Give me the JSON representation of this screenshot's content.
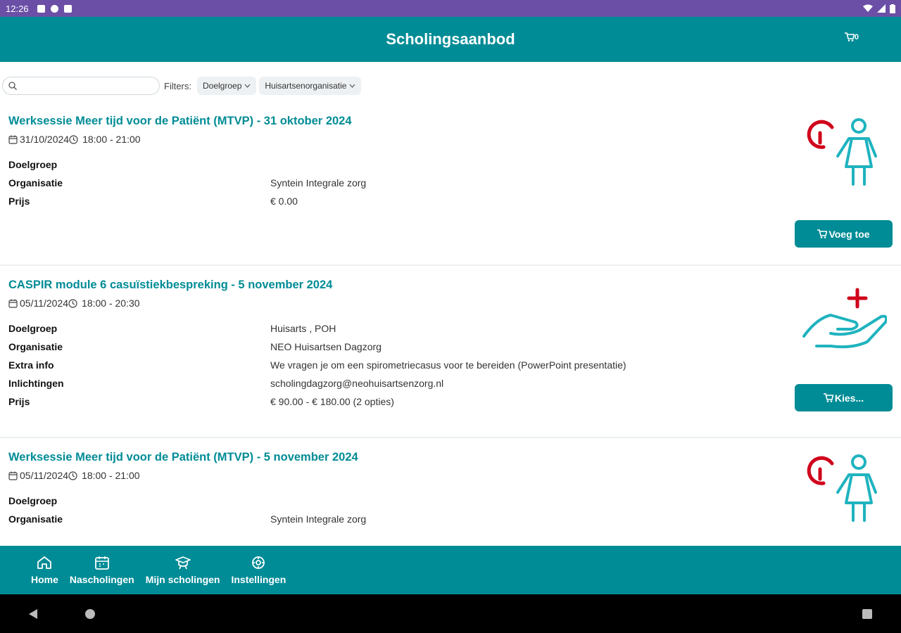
{
  "status": {
    "time": "12:26"
  },
  "appbar": {
    "title": "Scholingsaanbod",
    "cart_count": "0"
  },
  "filters": {
    "search_placeholder": "",
    "label": "Filters:",
    "chips": [
      "Doelgroep",
      "Huisartsenorganisatie"
    ]
  },
  "items": [
    {
      "title": "Werksessie Meer tijd voor de Patiënt (MTVP) - 31 oktober 2024",
      "date": "31/10/2024",
      "time": "18:00 - 21:00",
      "rows": [
        {
          "key": "Doelgroep",
          "value": ""
        },
        {
          "key": "Organisatie",
          "value": "Syntein Integrale zorg"
        },
        {
          "key": "Prijs",
          "value": "€ 0.00"
        }
      ],
      "button": "Voeg toe",
      "illustration": "clock-person-icon"
    },
    {
      "title": "CASPIR module 6 casuïstiekbespreking - 5 november 2024",
      "date": "05/11/2024",
      "time": "18:00 - 20:30",
      "rows": [
        {
          "key": "Doelgroep",
          "value": "Huisarts , POH"
        },
        {
          "key": "Organisatie",
          "value": "NEO Huisartsen Dagzorg"
        },
        {
          "key": "Extra info",
          "value": "We vragen je om een spirometriecasus voor te bereiden (PowerPoint presentatie)"
        },
        {
          "key": "Inlichtingen",
          "value": "scholingdagzorg@neohuisartsenzorg.nl"
        },
        {
          "key": "Prijs",
          "value": "€ 90.00 - € 180.00 (2 opties)"
        }
      ],
      "button": "Kies...",
      "illustration": "hand-plus-icon"
    },
    {
      "title": "Werksessie Meer tijd voor de Patiënt (MTVP) - 5 november 2024",
      "date": "05/11/2024",
      "time": "18:00 - 21:00",
      "rows": [
        {
          "key": "Doelgroep",
          "value": ""
        },
        {
          "key": "Organisatie",
          "value": "Syntein Integrale zorg"
        }
      ],
      "illustration": "clock-person-icon"
    }
  ],
  "nav": [
    {
      "label": "Home",
      "icon": "home-icon"
    },
    {
      "label": "Nascholingen",
      "icon": "calendar-icon"
    },
    {
      "label": "Mijn scholingen",
      "icon": "graduation-icon"
    },
    {
      "label": "Instellingen",
      "icon": "gear-icon"
    }
  ],
  "colors": {
    "primary": "#008c96",
    "statusbar": "#6b4fa6",
    "accent_red": "#d0021b"
  }
}
